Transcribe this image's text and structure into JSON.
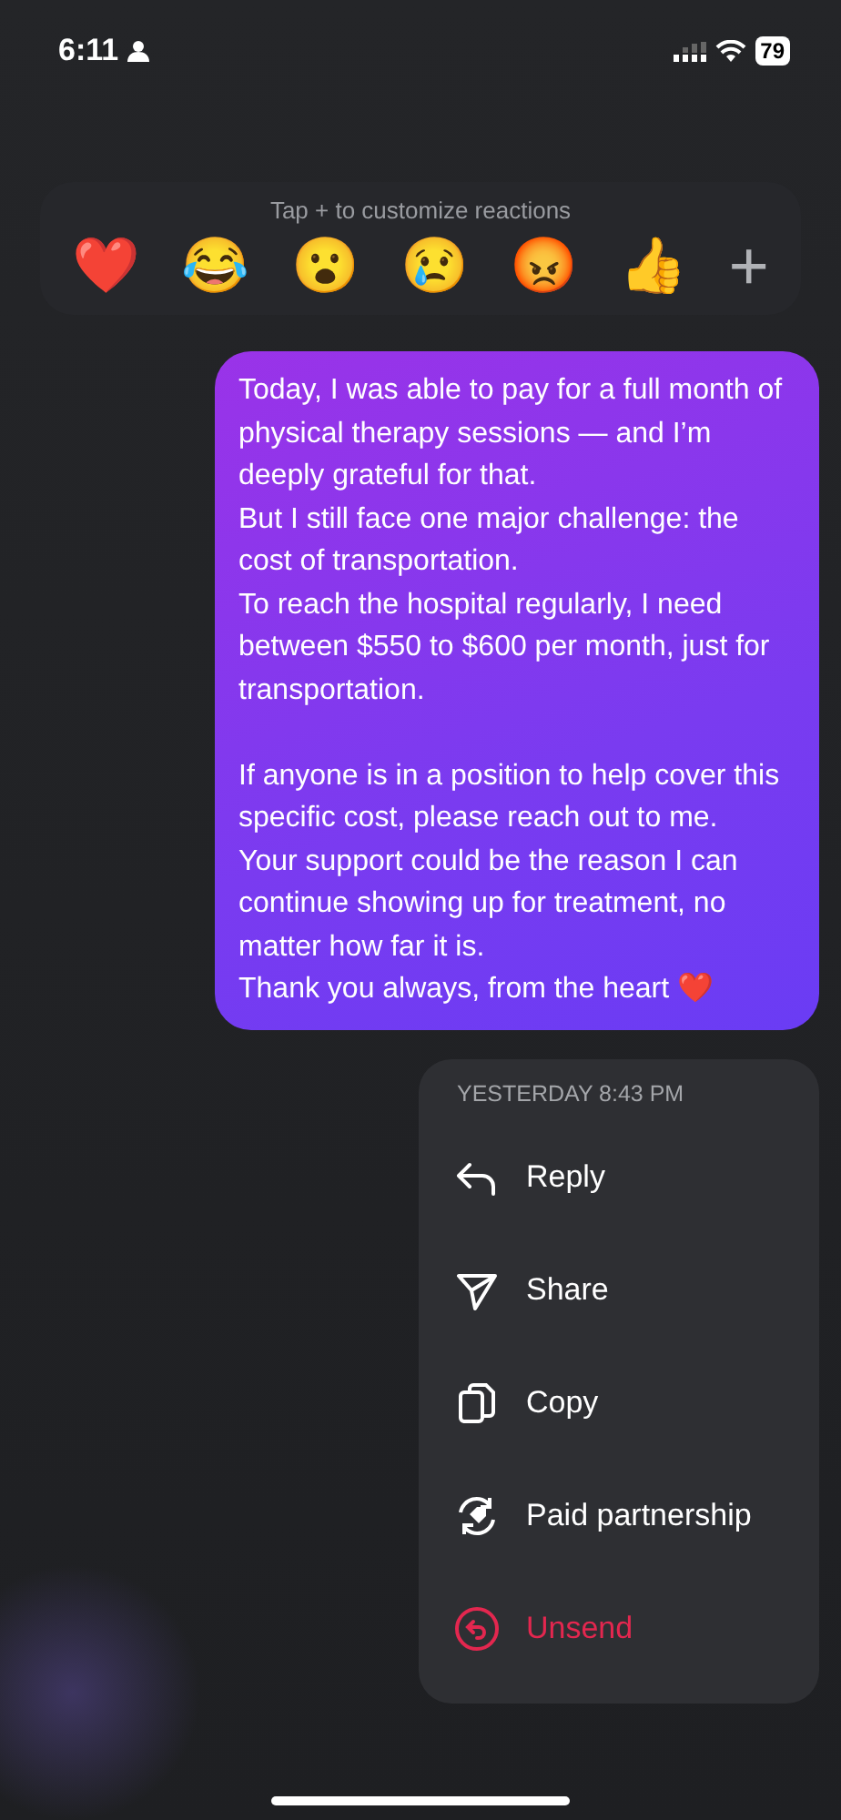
{
  "status_bar": {
    "time": "6:11",
    "battery": "79"
  },
  "reactions": {
    "hint": "Tap + to customize reactions",
    "emojis": [
      "❤️",
      "😂",
      "😮",
      "😢",
      "😡",
      "👍"
    ],
    "add": "+"
  },
  "message": {
    "blocks": [
      [
        "Today, I was able to pay for a full month of physical therapy sessions — and I’m deeply grateful for that.",
        "But I still face one major challenge: the cost of transportation.",
        "To reach the hospital regularly, I need between $550 to $600 per month, just for transportation."
      ],
      [
        "If anyone is in a position to help cover this specific cost, please reach out to me.",
        "Your support could be the reason I can continue showing up for treatment, no matter how far it is.",
        "Thank you always, from the heart ❤️"
      ]
    ]
  },
  "menu": {
    "timestamp": "YESTERDAY 8:43 PM",
    "items": [
      {
        "kind": "reply",
        "label": "Reply",
        "destructive": false
      },
      {
        "kind": "share",
        "label": "Share",
        "destructive": false
      },
      {
        "kind": "copy",
        "label": "Copy",
        "destructive": false
      },
      {
        "kind": "partnership",
        "label": "Paid partnership",
        "destructive": false
      },
      {
        "kind": "unsend",
        "label": "Unsend",
        "destructive": true
      }
    ]
  }
}
